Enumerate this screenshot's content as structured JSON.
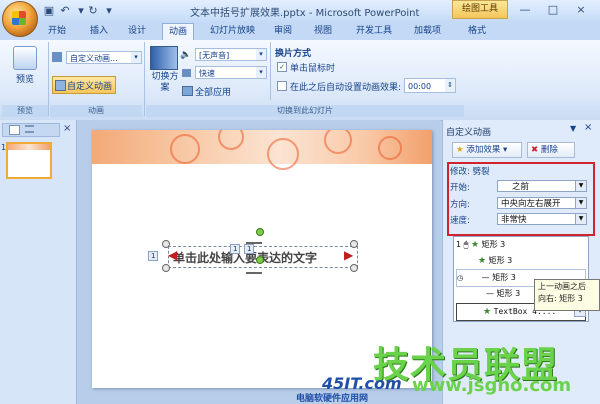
{
  "window": {
    "title": "文本中括号扩展效果.pptx - Microsoft PowerPoint",
    "contextual_tab": "绘图工具",
    "controls": [
      "—",
      "□",
      "×"
    ]
  },
  "quick_access": [
    "save-icon",
    "undo-icon",
    "redo-icon",
    "customize-icon"
  ],
  "tabs": [
    {
      "label": "开始"
    },
    {
      "label": "插入"
    },
    {
      "label": "设计"
    },
    {
      "label": "动画",
      "active": true
    },
    {
      "label": "幻灯片放映"
    },
    {
      "label": "审阅"
    },
    {
      "label": "视图"
    },
    {
      "label": "开发工具"
    },
    {
      "label": "加载项"
    },
    {
      "label": "格式"
    }
  ],
  "ribbon": {
    "preview": {
      "button": "预览",
      "group": "预览"
    },
    "animation": {
      "animate_combo": "自定义动画...",
      "custom_button": "自定义动画",
      "group": "动画"
    },
    "transition": {
      "scheme_button": "切换方案",
      "sound": "[无声音]",
      "speed": "快速",
      "apply_all": "全部应用",
      "advance_title": "换片方式",
      "on_click": "单击鼠标时",
      "after_label": "在此之后自动设置动画效果:",
      "after_value": "00:00",
      "group": "切换到此幻灯片"
    }
  },
  "thumbnails": {
    "slide_number": "1"
  },
  "slide": {
    "text": "单击此处输入要表达的文字",
    "anim_tags": [
      "1",
      "1",
      "1"
    ]
  },
  "custom_animation": {
    "title": "自定义动画",
    "add_effect": "添加效果",
    "remove": "删除",
    "modify_label": "修改: 劈裂",
    "start_label": "开始:",
    "start_value": "之前",
    "direction_label": "方向:",
    "direction_value": "中央向左右展开",
    "speed_label": "速度:",
    "speed_value": "非常快",
    "list": [
      {
        "num": "1",
        "name": "矩形 3",
        "icon": "star-icon"
      },
      {
        "num": "",
        "name": "矩形 3",
        "icon": "star-icon"
      },
      {
        "num": "",
        "name": "矩形 3",
        "icon": "line-icon"
      },
      {
        "num": "",
        "name": "矩形 3",
        "icon": "line-icon"
      },
      {
        "num": "",
        "name": "TextBox 4:...",
        "icon": "star-icon"
      }
    ],
    "tooltip_line1": "上一动画之后",
    "tooltip_line2": "向右: 矩形 3"
  },
  "watermark": {
    "brand_cn": "技术员联盟",
    "domain": "www.jsgho.com",
    "logo_text": "45IT.com",
    "logo_sub": "电脑软硬件应用网"
  },
  "colors": {
    "highlight_border": "#d0232b",
    "active_tab": "#f0f6ff",
    "watermark_green": "#6bd24b"
  }
}
